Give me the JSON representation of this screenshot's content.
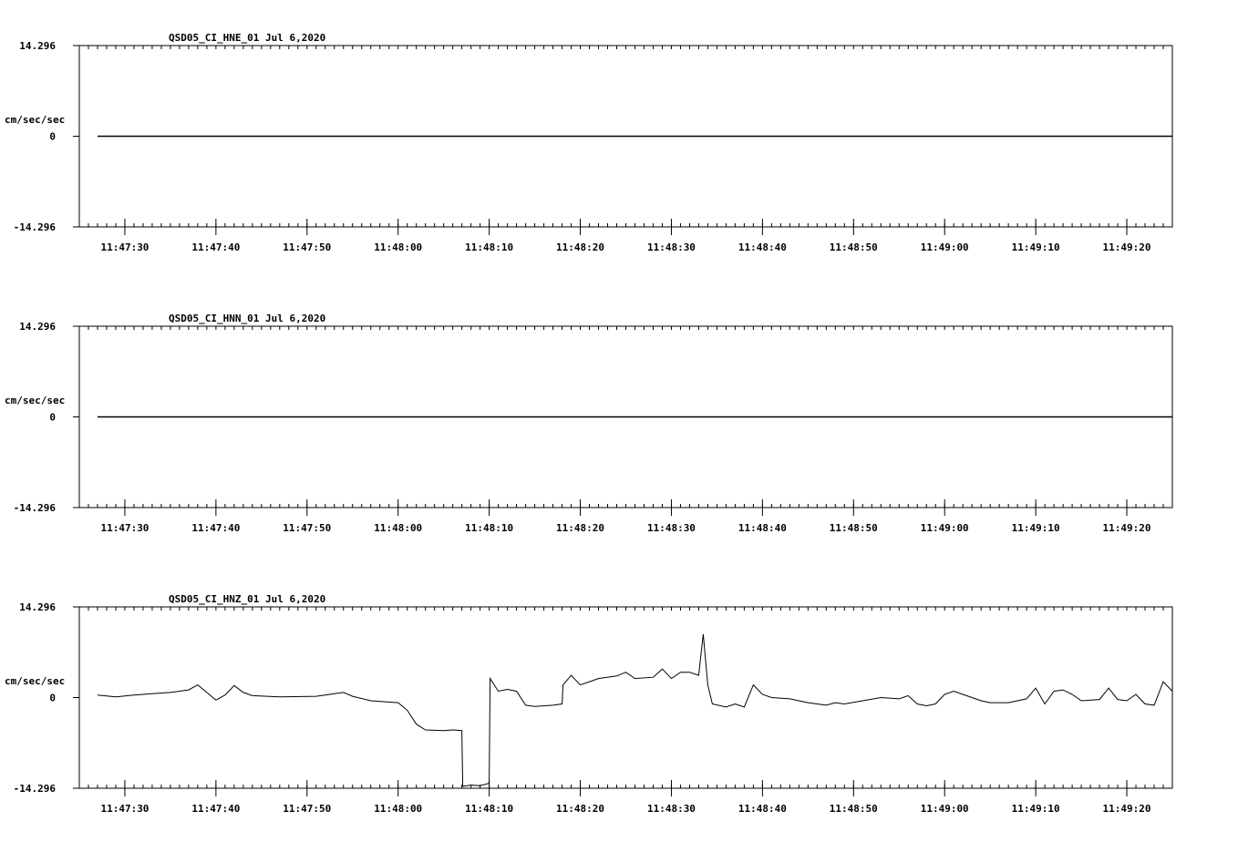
{
  "chart_data": [
    {
      "type": "line",
      "title": "QSD05_CI_HNE_01  Jul 6,2020",
      "ylabel": "cm/sec/sec",
      "yticks": [
        "14.296",
        "0",
        "-14.296"
      ],
      "ylim": [
        -14.296,
        14.296
      ],
      "xlim": [
        "11:47:25",
        "11:49:25"
      ],
      "xtick_labels": [
        "11:47:30",
        "11:47:40",
        "11:47:50",
        "11:48:00",
        "11:48:10",
        "11:48:20",
        "11:48:30",
        "11:48:40",
        "11:48:50",
        "11:49:00",
        "11:49:10",
        "11:49:20"
      ],
      "series": [
        {
          "x_start": "11:47:27",
          "x_end": "11:49:25",
          "points": [
            [
              0,
              0
            ],
            [
              118,
              0
            ]
          ]
        }
      ]
    },
    {
      "type": "line",
      "title": "QSD05_CI_HNN_01  Jul 6,2020",
      "ylabel": "cm/sec/sec",
      "yticks": [
        "14.296",
        "0",
        "-14.296"
      ],
      "ylim": [
        -14.296,
        14.296
      ],
      "xlim": [
        "11:47:25",
        "11:49:25"
      ],
      "xtick_labels": [
        "11:47:30",
        "11:47:40",
        "11:47:50",
        "11:48:00",
        "11:48:10",
        "11:48:20",
        "11:48:30",
        "11:48:40",
        "11:48:50",
        "11:49:00",
        "11:49:10",
        "11:49:20"
      ],
      "series": [
        {
          "x_start": "11:47:27",
          "x_end": "11:49:25",
          "points": [
            [
              0,
              0
            ],
            [
              118,
              0
            ]
          ]
        }
      ]
    },
    {
      "type": "line",
      "title": "QSD05_CI_HNZ_01  Jul 6,2020",
      "ylabel": "cm/sec/sec",
      "yticks": [
        "14.296",
        "0",
        "-14.296"
      ],
      "ylim": [
        -14.296,
        14.296
      ],
      "xlim": [
        "11:47:25",
        "11:49:25"
      ],
      "xtick_labels": [
        "11:47:30",
        "11:47:40",
        "11:47:50",
        "11:48:00",
        "11:48:10",
        "11:48:20",
        "11:48:30",
        "11:48:40",
        "11:48:50",
        "11:49:00",
        "11:49:10",
        "11:49:20"
      ],
      "series": [
        {
          "x_start": "11:47:27",
          "x_end": "11:49:25",
          "points": [
            [
              0,
              0.4
            ],
            [
              2,
              0.1
            ],
            [
              4,
              0.4
            ],
            [
              6,
              0.6
            ],
            [
              8,
              0.8
            ],
            [
              10,
              1.2
            ],
            [
              11,
              2.0
            ],
            [
              12,
              0.8
            ],
            [
              13,
              -0.4
            ],
            [
              14,
              0.4
            ],
            [
              15,
              1.9
            ],
            [
              16,
              0.8
            ],
            [
              17,
              0.3
            ],
            [
              20,
              0.1
            ],
            [
              24,
              0.2
            ],
            [
              26,
              0.6
            ],
            [
              27,
              0.8
            ],
            [
              28,
              0.2
            ],
            [
              30,
              -0.5
            ],
            [
              33,
              -0.8
            ],
            [
              34,
              -2.0
            ],
            [
              35,
              -4.2
            ],
            [
              36,
              -5.1
            ],
            [
              38,
              -5.2
            ],
            [
              39,
              -5.1
            ],
            [
              40,
              -5.2
            ],
            [
              40.1,
              -14.0
            ],
            [
              41,
              -13.8
            ],
            [
              42,
              -13.9
            ],
            [
              43,
              -13.5
            ],
            [
              43.1,
              3.0
            ],
            [
              44,
              1.0
            ],
            [
              45,
              1.3
            ],
            [
              46,
              1.0
            ],
            [
              47,
              -1.2
            ],
            [
              48,
              -1.4
            ],
            [
              50,
              -1.2
            ],
            [
              51,
              -1.0
            ],
            [
              51.1,
              2.0
            ],
            [
              52,
              3.5
            ],
            [
              53,
              2.0
            ],
            [
              54,
              2.5
            ],
            [
              55,
              3.0
            ],
            [
              57,
              3.4
            ],
            [
              58,
              4.0
            ],
            [
              59,
              3.0
            ],
            [
              61,
              3.2
            ],
            [
              62,
              4.5
            ],
            [
              63,
              3.0
            ],
            [
              64,
              4.0
            ],
            [
              65,
              4.0
            ],
            [
              66,
              3.5
            ],
            [
              66.5,
              10.0
            ],
            [
              67,
              2.0
            ],
            [
              67.5,
              -1.0
            ],
            [
              69,
              -1.5
            ],
            [
              70,
              -1.0
            ],
            [
              71,
              -1.5
            ],
            [
              72,
              2.0
            ],
            [
              73,
              0.5
            ],
            [
              74,
              0.0
            ],
            [
              76,
              -0.2
            ],
            [
              78,
              -0.8
            ],
            [
              80,
              -1.2
            ],
            [
              81,
              -0.8
            ],
            [
              82,
              -1.0
            ],
            [
              84,
              -0.5
            ],
            [
              86,
              0.0
            ],
            [
              88,
              -0.2
            ],
            [
              89,
              0.3
            ],
            [
              90,
              -1.0
            ],
            [
              91,
              -1.3
            ],
            [
              92,
              -1.0
            ],
            [
              93,
              0.5
            ],
            [
              94,
              1.0
            ],
            [
              95,
              0.5
            ],
            [
              96,
              0.0
            ],
            [
              97,
              -0.5
            ],
            [
              98,
              -0.8
            ],
            [
              100,
              -0.8
            ],
            [
              102,
              -0.2
            ],
            [
              103,
              1.5
            ],
            [
              104,
              -1.0
            ],
            [
              105,
              1.0
            ],
            [
              106,
              1.2
            ],
            [
              107,
              0.5
            ],
            [
              108,
              -0.5
            ],
            [
              110,
              -0.3
            ],
            [
              111,
              1.5
            ],
            [
              112,
              -0.3
            ],
            [
              113,
              -0.5
            ],
            [
              114,
              0.5
            ],
            [
              115,
              -1.0
            ],
            [
              116,
              -1.2
            ],
            [
              117,
              2.5
            ],
            [
              118,
              1.0
            ]
          ]
        }
      ]
    }
  ]
}
